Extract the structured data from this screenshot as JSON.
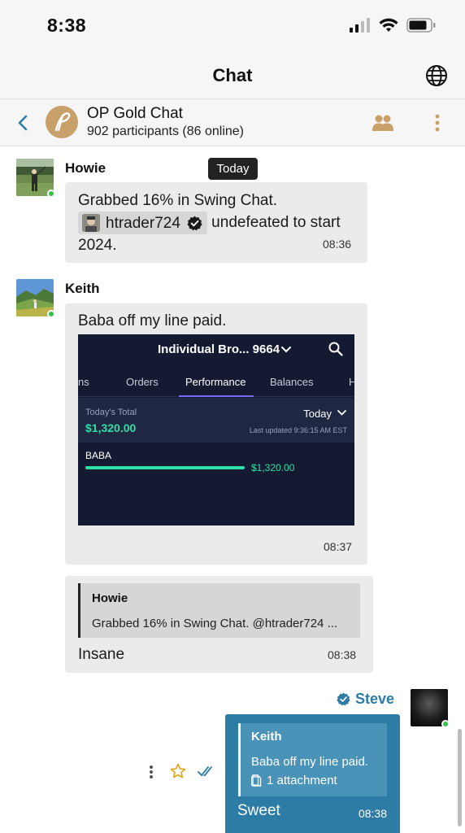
{
  "status_bar": {
    "time": "8:38"
  },
  "top_nav": {
    "title": "Chat"
  },
  "chat_header": {
    "group_name": "OP Gold Chat",
    "participants": "902 participants (86 online)"
  },
  "date_divider": "Today",
  "messages": [
    {
      "sender": "Howie",
      "text_before": "Grabbed 16% in Swing Chat.",
      "mention": "htrader724",
      "text_after": " undefeated to start",
      "text_last": "2024.",
      "time": "08:36"
    },
    {
      "sender": "Keith",
      "text": "Baba off my line paid.",
      "time": "08:37",
      "attachment": {
        "account": "Individual Bro... 9664",
        "tabs": [
          "ns",
          "Orders",
          "Performance",
          "Balances",
          "H"
        ],
        "active_tab": "Performance",
        "total_label": "Today's Total",
        "total_value": "$1,320.00",
        "period": "Today",
        "updated": "Last updated 9:36:15 AM EST",
        "ticker": "BABA",
        "ticker_value": "$1,320.00",
        "accent_color": "#2ee0a6"
      }
    },
    {
      "reply_to": {
        "name": "Howie",
        "text": "Grabbed 16% in Swing Chat. @htrader724 ..."
      },
      "text": "Insane",
      "time": "08:38"
    }
  ],
  "own_message": {
    "sender": "Steve",
    "reply_to": {
      "name": "Keith",
      "text": "Baba off my line paid.",
      "attachment": "1 attachment"
    },
    "text": "Sweet",
    "time": "08:38",
    "bubble_color": "#2d7ca5"
  }
}
